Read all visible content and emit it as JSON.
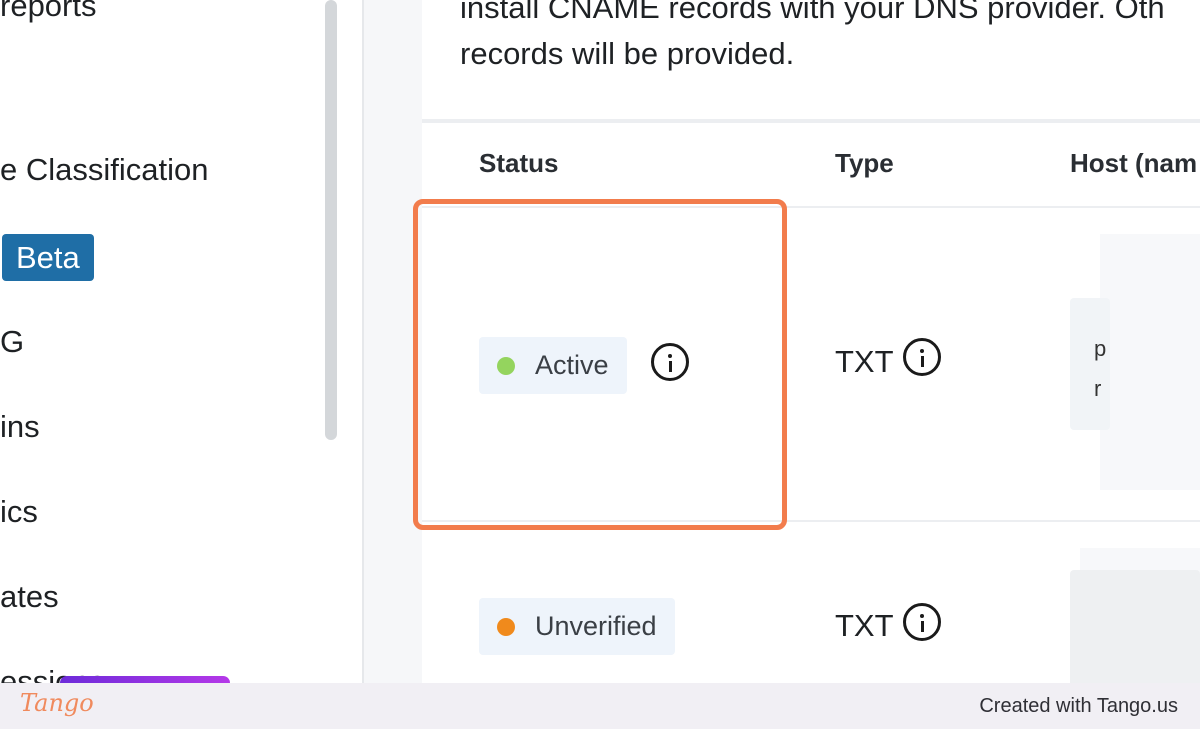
{
  "sidebar": {
    "items": [
      {
        "label": "reports"
      },
      {
        "label": "e Classification"
      },
      {
        "label": "Beta"
      },
      {
        "label": "G"
      },
      {
        "label": "ins"
      },
      {
        "label": "ics"
      },
      {
        "label": "ates"
      },
      {
        "label": "essions"
      }
    ]
  },
  "main": {
    "intro_line1": "install CNAME records with your DNS provider. Oth",
    "intro_line2": "records will be provided.",
    "columns": [
      "Status",
      "Type",
      "Host (nam"
    ],
    "rows": [
      {
        "status": "Active",
        "status_color": "#94d45e",
        "type": "TXT",
        "host_fragments": [
          "p",
          "r"
        ]
      },
      {
        "status": "Unverified",
        "status_color": "#f08a1c",
        "type": "TXT"
      }
    ]
  },
  "footer": {
    "logo": "Tango",
    "credit": "Created with Tango.us"
  },
  "colors": {
    "highlight": "#f27c4c",
    "beta_badge": "#1f6ea6"
  }
}
